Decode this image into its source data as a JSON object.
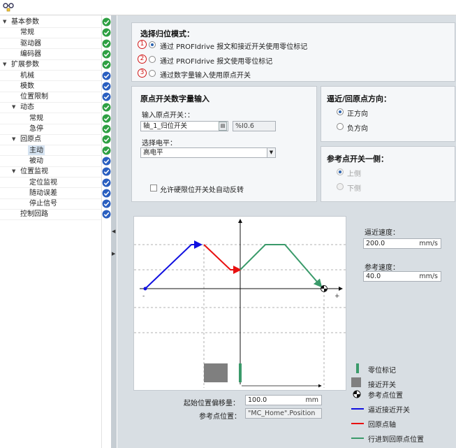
{
  "tree": {
    "items": [
      {
        "label": "基本参数",
        "status": "ok"
      },
      {
        "label": "常规",
        "status": "ok"
      },
      {
        "label": "驱动器",
        "status": "ok"
      },
      {
        "label": "编码器",
        "status": "ok"
      },
      {
        "label": "扩展参数",
        "status": "ok"
      },
      {
        "label": "机械",
        "status": "ok-blue"
      },
      {
        "label": "模数",
        "status": "ok-blue"
      },
      {
        "label": "位置限制",
        "status": "ok-blue"
      },
      {
        "label": "动态",
        "status": "ok"
      },
      {
        "label": "常规",
        "status": "ok"
      },
      {
        "label": "急停",
        "status": "ok"
      },
      {
        "label": "回原点",
        "status": "ok"
      },
      {
        "label": "主动",
        "status": "ok"
      },
      {
        "label": "被动",
        "status": "ok-blue"
      },
      {
        "label": "位置监视",
        "status": "ok-blue"
      },
      {
        "label": "定位监视",
        "status": "ok-blue"
      },
      {
        "label": "随动误差",
        "status": "ok-blue"
      },
      {
        "label": "停止信号",
        "status": "ok-blue"
      },
      {
        "label": "控制回路",
        "status": "ok-blue"
      }
    ]
  },
  "mode_panel": {
    "title": "选择归位模式：",
    "options": [
      {
        "num": "1",
        "label": "通过 PROFIdrive 报文和接近开关使用零位标记",
        "selected": true
      },
      {
        "num": "2",
        "label": "通过 PROFIdrive 报文使用零位标记",
        "selected": false
      },
      {
        "num": "3",
        "label": "通过数字量输入使用原点开关",
        "selected": false
      }
    ]
  },
  "home_switch": {
    "title": "原点开关数字量输入",
    "input_label": "输入原点开关：：",
    "input_value": "轴_1_归位开关",
    "address": "%I0.6",
    "level_label": "选择电平：",
    "level_value": "高电平",
    "auto_reverse_label": "允许硬限位开关处自动反转",
    "auto_reverse_checked": false
  },
  "direction": {
    "title": "逼近/回原点方向：",
    "options": [
      {
        "label": "正方向",
        "selected": true
      },
      {
        "label": "负方向",
        "selected": false
      }
    ]
  },
  "ref_side": {
    "title": "参考点开关一侧：",
    "options": [
      {
        "label": "上侧",
        "selected": true,
        "disabled": true
      },
      {
        "label": "下侧",
        "selected": false,
        "disabled": true
      }
    ]
  },
  "speeds": {
    "approach_label": "逼近速度：",
    "approach_value": "200.0",
    "approach_unit": "mm/s",
    "ref_label": "参考速度：",
    "ref_value": "40.0",
    "ref_unit": "mm/s"
  },
  "offset": {
    "label": "起始位置偏移量：",
    "value": "100.0",
    "unit": "mm",
    "ref_pos_label": "参考点位置：",
    "ref_pos_value": "\"MC_Home\".Position"
  },
  "diagram": {
    "minus": "-",
    "plus": "+"
  },
  "legend": [
    {
      "icon": "zero-mark",
      "label": "零位标记"
    },
    {
      "icon": "proximity-switch",
      "label": "接近开关"
    },
    {
      "icon": "reference-point",
      "label": "参考点位置"
    },
    {
      "icon": "blue-line",
      "label": "逼近接近开关"
    },
    {
      "icon": "red-line",
      "label": "回原点轴"
    },
    {
      "icon": "green-line",
      "label": "行进到回原点位置"
    }
  ],
  "colors": {
    "approach": "#1010e0",
    "homing": "#e81010",
    "travel": "#3a9a6a",
    "ok_green": "#2ea043",
    "ok_blue": "#2a5fc0",
    "marker": "#d01818"
  }
}
